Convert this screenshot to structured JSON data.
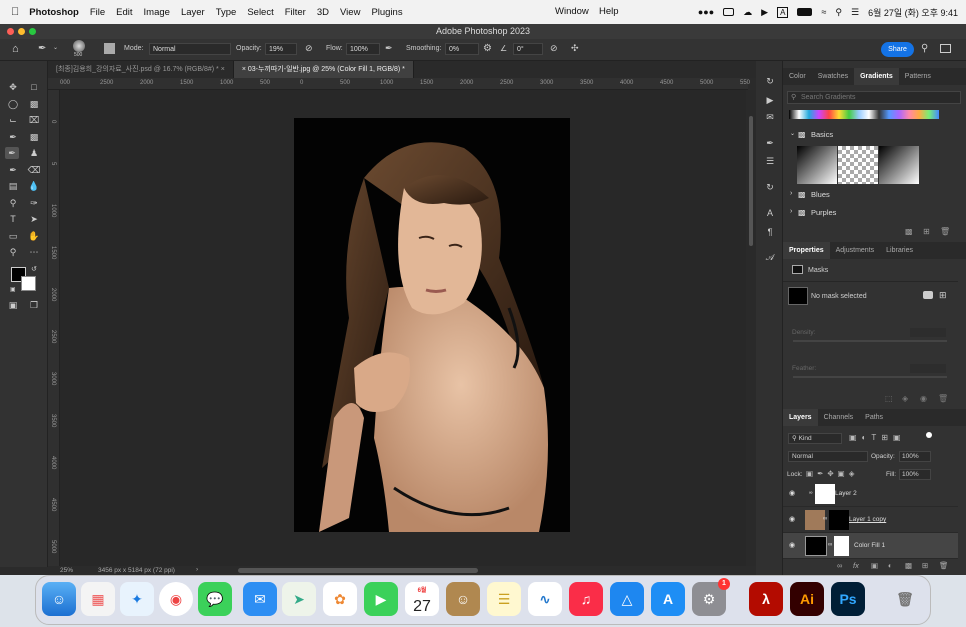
{
  "menubar": {
    "app": "Photoshop",
    "items": [
      "File",
      "Edit",
      "Image",
      "Layer",
      "Type",
      "Select",
      "Filter",
      "3D",
      "View",
      "Plugins",
      "Window",
      "Help"
    ],
    "input_badge": "A",
    "datetime": "6월 27일 (화) 오후 9:41"
  },
  "window": {
    "title": "Adobe Photoshop 2023"
  },
  "options": {
    "brush_size": "500",
    "mode_label": "Mode:",
    "mode_value": "Normal",
    "opacity_label": "Opacity:",
    "opacity_value": "19%",
    "flow_label": "Flow:",
    "flow_value": "100%",
    "smoothing_label": "Smoothing:",
    "smoothing_value": "0%",
    "angle_value": "0°",
    "share": "Share"
  },
  "tabs": [
    {
      "label": "[최종]김용희_강의자료_사진.psd @ 16.7% (RGB/8#) *"
    },
    {
      "label": "03-누끼따기-일반.jpg @ 25% (Color Fill 1, RGB/8) *"
    }
  ],
  "ruler": {
    "h_ticks": [
      "000",
      "2500",
      "2000",
      "1500",
      "1000",
      "500",
      "0",
      "500",
      "1000",
      "1500",
      "2000",
      "2500",
      "3000",
      "3500",
      "4000",
      "4500",
      "5000",
      "550"
    ],
    "v_ticks": [
      "0",
      "5",
      "1000",
      "1500",
      "2000",
      "2500",
      "3000",
      "3500",
      "4000",
      "4500",
      "5000"
    ]
  },
  "status": {
    "zoom": "25%",
    "doc_info": "3456 px x 5184 px (72 ppi)"
  },
  "gradients_panel": {
    "tabs": [
      "Color",
      "Swatches",
      "Gradients",
      "Patterns"
    ],
    "search_placeholder": "Search Gradients",
    "groups": [
      "Basics",
      "Blues",
      "Purples"
    ]
  },
  "properties_panel": {
    "tabs": [
      "Properties",
      "Adjustments",
      "Libraries"
    ],
    "section": "Masks",
    "mask_status": "No mask selected",
    "density_label": "Density:",
    "feather_label": "Feather:"
  },
  "layers_panel": {
    "tabs": [
      "Layers",
      "Channels",
      "Paths"
    ],
    "filter_kind": "Kind",
    "blend_mode": "Normal",
    "opacity_label": "Opacity:",
    "opacity_value": "100%",
    "lock_label": "Lock:",
    "fill_label": "Fill:",
    "fill_value": "100%",
    "layers": [
      {
        "name": "Layer 2"
      },
      {
        "name": "Layer 1 copy"
      },
      {
        "name": "Color Fill 1"
      }
    ]
  },
  "dock": {
    "calendar_month": "6월",
    "calendar_day": "27",
    "settings_badge": "1",
    "ai_label": "Ai",
    "ps_label": "Ps"
  }
}
